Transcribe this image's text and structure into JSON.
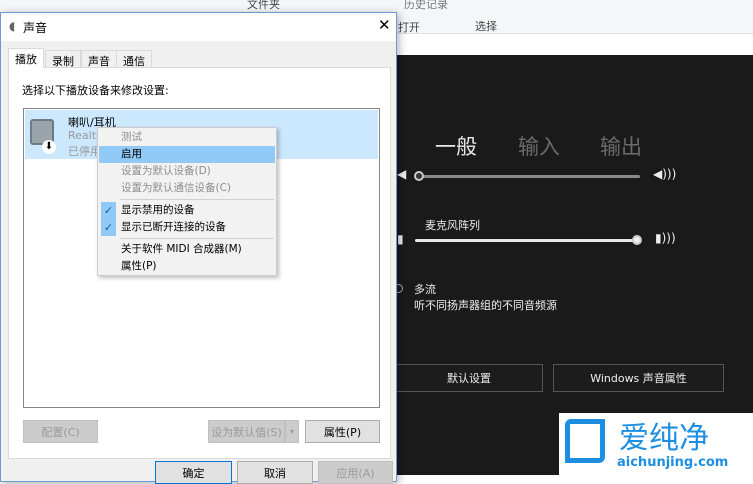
{
  "background": {
    "ribbon": {
      "folder": "文件夹",
      "history": "历史记录",
      "open": "打开",
      "select": "选择"
    },
    "audio_panel": {
      "tabs": [
        "一般",
        "输入",
        "输出"
      ],
      "mic_label": "麦克风阵列",
      "output_volume": 0,
      "mic_volume": 100,
      "multistream_title": "多流",
      "multistream_desc": "听不同扬声器组的不同音频源",
      "default_button": "默认设置",
      "sound_props_button": "Windows 声音属性"
    }
  },
  "dialog": {
    "title": "声音",
    "tabs": [
      "播放",
      "录制",
      "声音",
      "通信"
    ],
    "instruction": "选择以下播放设备来修改设置:",
    "device": {
      "name": "喇叭/耳机",
      "driver": "Realte",
      "status": "已停用"
    },
    "buttons": {
      "configure": "配置(C)",
      "set_default": "设为默认值(S)",
      "properties": "属性(P)",
      "ok": "确定",
      "cancel": "取消",
      "apply": "应用(A)"
    }
  },
  "context_menu": {
    "items": [
      "测试",
      "启用",
      "设置为默认设备(D)",
      "设置为默认通信设备(C)",
      "显示禁用的设备",
      "显示已断开连接的设备",
      "关于软件 MIDI 合成器(M)",
      "属性(P)"
    ],
    "check": "✓"
  },
  "watermark": {
    "brand": "爱纯净",
    "url": "aichunjing.com"
  },
  "colors": {
    "selection": "#cce8ff",
    "menu_highlight": "#91c9f7",
    "dark_bg": "#1a1a1a"
  }
}
